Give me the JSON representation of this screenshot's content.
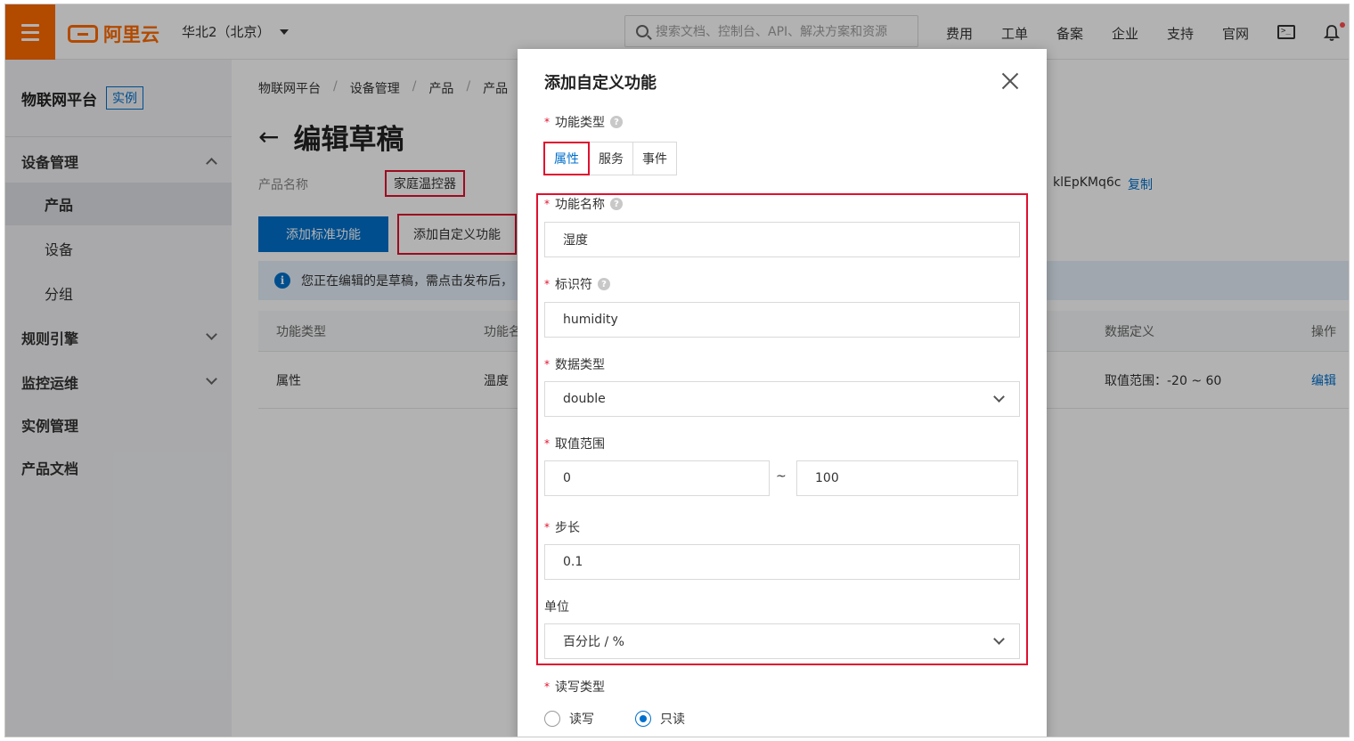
{
  "topbar": {
    "logo_text": "阿里云",
    "region": "华北2（北京）",
    "search_placeholder": "搜索文档、控制台、API、解决方案和资源",
    "links": [
      "费用",
      "工单",
      "备案",
      "企业",
      "支持",
      "官网"
    ]
  },
  "sidebar": {
    "title": "物联网平台",
    "badge": "实例",
    "items": [
      {
        "label": "设备管理",
        "type": "group",
        "expanded": true
      },
      {
        "label": "产品",
        "type": "sub",
        "active": true
      },
      {
        "label": "设备",
        "type": "sub"
      },
      {
        "label": "分组",
        "type": "sub"
      },
      {
        "label": "规则引擎",
        "type": "group",
        "expanded": false
      },
      {
        "label": "监控运维",
        "type": "group",
        "expanded": false
      },
      {
        "label": "实例管理",
        "type": "group"
      },
      {
        "label": "产品文档",
        "type": "group"
      }
    ],
    "collapse_glyph": "‹"
  },
  "main": {
    "breadcrumb": [
      "物联网平台",
      "设备管理",
      "产品",
      "产品"
    ],
    "title": "编辑草稿",
    "back_glyph": "←",
    "product_label": "产品名称",
    "product_name": "家庭温控器",
    "product_key_fragment": "klEpKMq6c",
    "copy_label": "复制",
    "btn_standard": "添加标准功能",
    "btn_custom": "添加自定义功能",
    "notice": "您正在编辑的是草稿，需点击发布后，",
    "table": {
      "headers": [
        "功能类型",
        "功能名",
        "数据定义",
        "操作"
      ],
      "row": {
        "type": "属性",
        "name": "温度",
        "definition": "取值范围：-20 ~ 60",
        "action": "编辑"
      }
    }
  },
  "modal": {
    "title": "添加自定义功能",
    "function_type_label": "功能类型",
    "function_types": [
      "属性",
      "服务",
      "事件"
    ],
    "selected_type": "属性",
    "name_label": "功能名称",
    "name_value": "湿度",
    "identifier_label": "标识符",
    "identifier_value": "humidity",
    "data_type_label": "数据类型",
    "data_type_value": "double",
    "range_label": "取值范围",
    "range_min": "0",
    "range_sep": "~",
    "range_max": "100",
    "step_label": "步长",
    "step_value": "0.1",
    "unit_label": "单位",
    "unit_value": "百分比 / %",
    "rw_label": "读写类型",
    "rw_options": [
      "读写",
      "只读"
    ],
    "rw_selected": "只读"
  },
  "colors": {
    "brand": "#ff6a00",
    "primary": "#0070cc",
    "highlight": "#e0102e"
  }
}
